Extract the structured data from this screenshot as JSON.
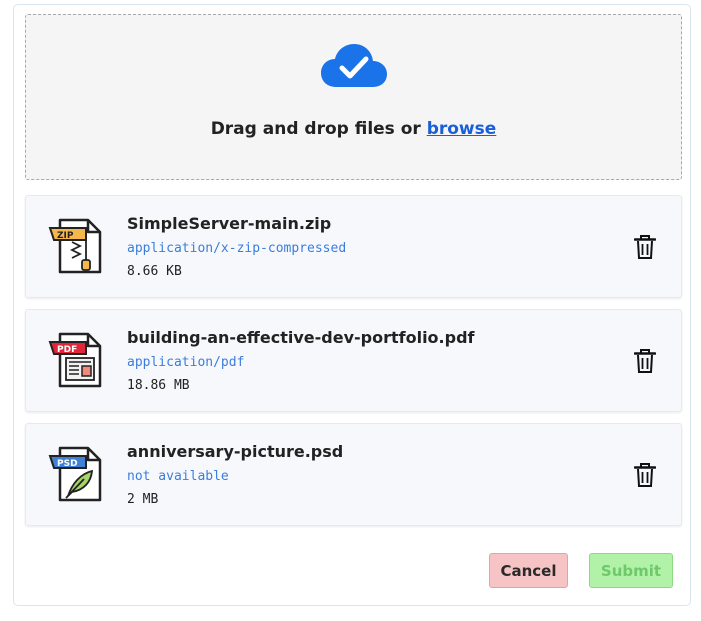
{
  "dropzone": {
    "text": "Drag and drop files or ",
    "link": "browse",
    "icon": "cloud-check-icon",
    "accent": "#1a73e8"
  },
  "files": [
    {
      "name": "SimpleServer-main.zip",
      "type": "application/x-zip-compressed",
      "size": "8.66 KB",
      "icon": "zip-file-icon",
      "badge": "ZIP",
      "badge_color": "#f7b84b"
    },
    {
      "name": "building-an-effective-dev-portfolio.pdf",
      "type": "application/pdf",
      "size": "18.86 MB",
      "icon": "pdf-file-icon",
      "badge": "PDF",
      "badge_color": "#e2263a"
    },
    {
      "name": "anniversary-picture.psd",
      "type": "not available",
      "size": "2 MB",
      "icon": "psd-file-icon",
      "badge": "PSD",
      "badge_color": "#3d82d6"
    }
  ],
  "actions": {
    "cancel": "Cancel",
    "submit": "Submit"
  }
}
